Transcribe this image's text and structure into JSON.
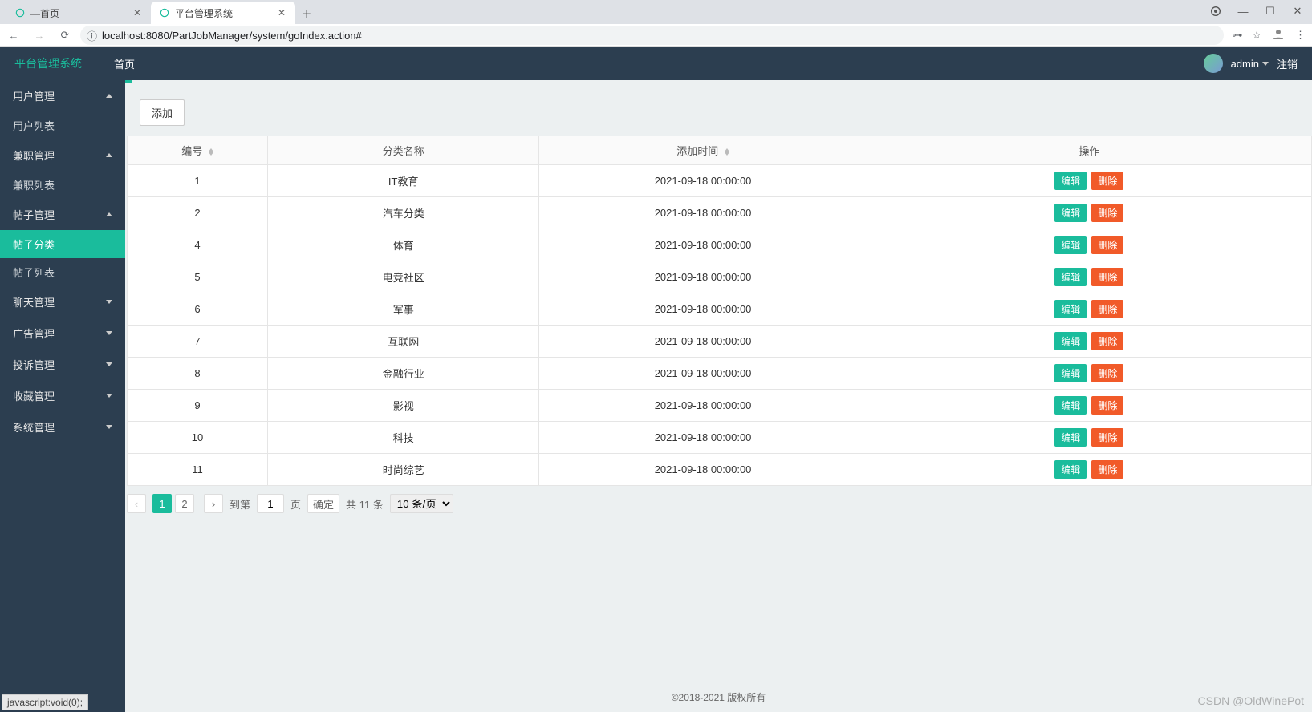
{
  "browser": {
    "tabs": [
      {
        "title": "—首页",
        "active": false
      },
      {
        "title": "平台管理系统",
        "active": true
      }
    ],
    "url": "localhost:8080/PartJobManager/system/goIndex.action#"
  },
  "header": {
    "brand": "平台管理系统",
    "nav_home": "首页",
    "user": "admin",
    "logout": "注销"
  },
  "sidebar": {
    "groups": [
      {
        "label": "用户管理",
        "expanded": true,
        "items": [
          "用户列表"
        ]
      },
      {
        "label": "兼职管理",
        "expanded": true,
        "items": [
          "兼职列表"
        ]
      },
      {
        "label": "帖子管理",
        "expanded": true,
        "items": [
          "帖子分类",
          "帖子列表"
        ],
        "active_item": "帖子分类"
      },
      {
        "label": "聊天管理",
        "expanded": false
      },
      {
        "label": "广告管理",
        "expanded": false
      },
      {
        "label": "投诉管理",
        "expanded": false
      },
      {
        "label": "收藏管理",
        "expanded": false
      },
      {
        "label": "系统管理",
        "expanded": false
      }
    ]
  },
  "main": {
    "add_button": "添加",
    "columns": {
      "id": "编号",
      "name": "分类名称",
      "time": "添加时间",
      "ops": "操作"
    },
    "rows": [
      {
        "id": "1",
        "name": "IT教育",
        "time": "2021-09-18 00:00:00"
      },
      {
        "id": "2",
        "name": "汽车分类",
        "time": "2021-09-18 00:00:00"
      },
      {
        "id": "4",
        "name": "体育",
        "time": "2021-09-18 00:00:00"
      },
      {
        "id": "5",
        "name": "电竞社区",
        "time": "2021-09-18 00:00:00"
      },
      {
        "id": "6",
        "name": "军事",
        "time": "2021-09-18 00:00:00"
      },
      {
        "id": "7",
        "name": "互联网",
        "time": "2021-09-18 00:00:00"
      },
      {
        "id": "8",
        "name": "金融行业",
        "time": "2021-09-18 00:00:00"
      },
      {
        "id": "9",
        "name": "影视",
        "time": "2021-09-18 00:00:00"
      },
      {
        "id": "10",
        "name": "科技",
        "time": "2021-09-18 00:00:00"
      },
      {
        "id": "11",
        "name": "时尚综艺",
        "time": "2021-09-18 00:00:00"
      }
    ],
    "row_buttons": {
      "edit": "编辑",
      "delete": "删除"
    },
    "pagination": {
      "pages": [
        "1",
        "2"
      ],
      "current": "1",
      "to_label": "到第",
      "page_input": "1",
      "page_suffix": "页",
      "confirm": "确定",
      "total": "共 11 条",
      "page_size": "10 条/页"
    }
  },
  "footer": "©2018-2021           版权所有",
  "status_bar": "javascript:void(0);",
  "watermark": "CSDN @OldWinePot"
}
